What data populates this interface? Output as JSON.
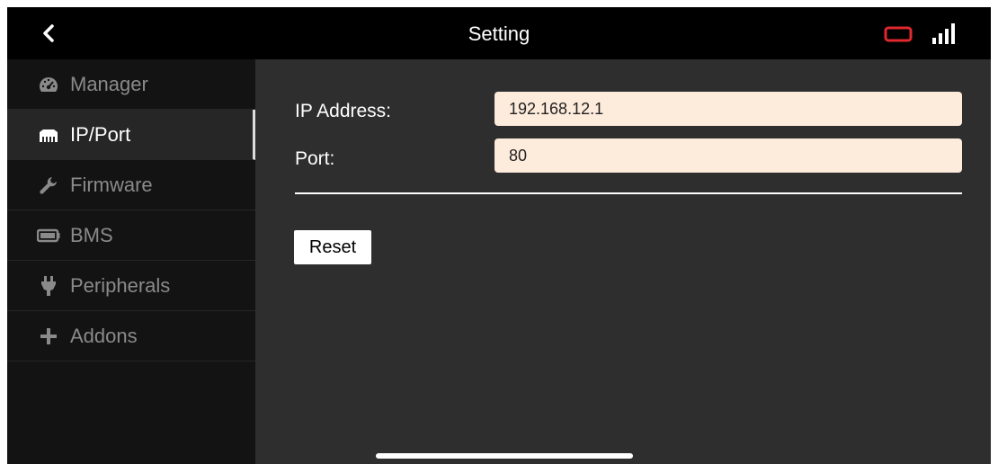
{
  "header": {
    "title": "Setting",
    "back_icon": "chevron-left-icon",
    "battery_icon": "battery-icon",
    "signal_icon": "signal-bars-icon",
    "battery_color": "#e0282e"
  },
  "sidebar": {
    "items": [
      {
        "label": "Manager",
        "icon": "dashboard-icon",
        "active": false
      },
      {
        "label": "IP/Port",
        "icon": "ethernet-icon",
        "active": true
      },
      {
        "label": "Firmware",
        "icon": "wrench-icon",
        "active": false
      },
      {
        "label": "BMS",
        "icon": "battery-pack-icon",
        "active": false
      },
      {
        "label": "Peripherals",
        "icon": "plug-icon",
        "active": false
      },
      {
        "label": "Addons",
        "icon": "plus-icon",
        "active": false
      }
    ]
  },
  "main": {
    "ip_label": "IP Address:",
    "ip_value": "192.168.12.1",
    "port_label": "Port:",
    "port_value": "80",
    "reset_label": "Reset"
  },
  "colors": {
    "input_background": "#fdebdc",
    "sidebar_background": "#131313",
    "main_background": "#2e2e2e"
  }
}
